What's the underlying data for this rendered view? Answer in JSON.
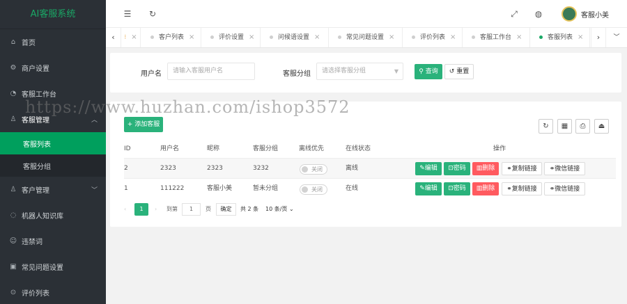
{
  "app": {
    "title": "AI客服系统"
  },
  "sidebar": {
    "items": [
      {
        "label": "首页",
        "icon": "home-icon"
      },
      {
        "label": "商户设置",
        "icon": "gear-icon"
      },
      {
        "label": "客服工作台",
        "icon": "headset-icon"
      },
      {
        "label": "客服管理",
        "icon": "user-icon"
      },
      {
        "label": "客户管理",
        "icon": "users-icon"
      },
      {
        "label": "机器人知识库",
        "icon": "robot-icon"
      },
      {
        "label": "违禁词",
        "icon": "forbidden-icon"
      },
      {
        "label": "常见问题设置",
        "icon": "question-icon"
      },
      {
        "label": "评价列表",
        "icon": "star-icon"
      }
    ],
    "sub_items": [
      {
        "label": "客服列表"
      },
      {
        "label": "客服分组"
      }
    ]
  },
  "header": {
    "user_name": "客服小美",
    "icons": [
      "menu-fold-icon",
      "refresh-icon",
      "fullscreen-icon",
      "globe-icon"
    ]
  },
  "tabs": [
    {
      "label": "客户列表"
    },
    {
      "label": "评价设置"
    },
    {
      "label": "问候语设置"
    },
    {
      "label": "常见问题设置"
    },
    {
      "label": "评价列表"
    },
    {
      "label": "客服工作台"
    },
    {
      "label": "客服列表",
      "active": true
    }
  ],
  "search": {
    "username_label": "用户名",
    "username_placeholder": "请输入客服用户名",
    "group_label": "客服分组",
    "group_placeholder": "请选择客服分组",
    "query_label": "查询",
    "reset_label": "重置"
  },
  "table": {
    "add_label": "添加客服",
    "columns": [
      "ID",
      "用户名",
      "昵称",
      "客服分组",
      "离线优先",
      "在线状态",
      "操作"
    ],
    "rows": [
      {
        "id": "2",
        "username": "2323",
        "nickname": "2323",
        "group": "3232",
        "offline_first": "关闭",
        "status": "离线"
      },
      {
        "id": "1",
        "username": "111222",
        "nickname": "客服小美",
        "group": "暂未分组",
        "offline_first": "关闭",
        "status": "在线"
      }
    ],
    "actions": {
      "edit": "编辑",
      "password": "密码",
      "delete": "删除",
      "copy_link": "复制链接",
      "wechat_link": "微信链接"
    }
  },
  "pagination": {
    "current_page": "1",
    "goto_label": "到第",
    "goto_value": "1",
    "page_suffix": "页",
    "confirm_label": "确定",
    "total_text": "共 2 条",
    "page_size": "10 条/页"
  },
  "watermark": "https://www.huzhan.com/ishop3572",
  "colors": {
    "accent": "#009f5d",
    "danger": "#ff5a5f",
    "sidebar_bg": "#2b3036"
  }
}
